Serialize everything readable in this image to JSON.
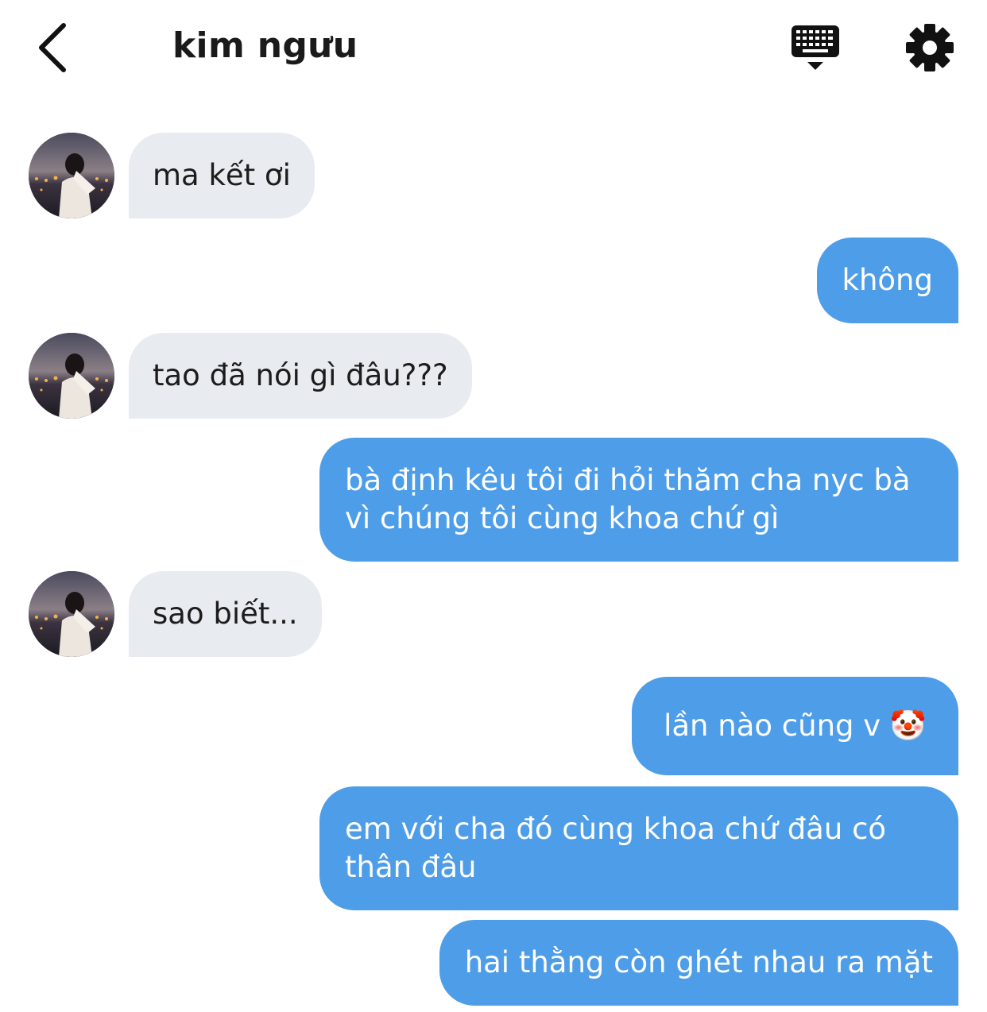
{
  "header": {
    "title": "kim ngưu",
    "back_icon": "chevron-left-icon",
    "keyboard_icon": "keyboard-icon",
    "settings_icon": "gear-icon"
  },
  "colors": {
    "incoming_bubble": "#e8ebef",
    "outgoing_bubble": "#4e9de8",
    "incoming_text": "#1c1c1c",
    "outgoing_text": "#ffffff"
  },
  "messages": [
    {
      "direction": "incoming",
      "text": "ma kết ơi"
    },
    {
      "direction": "outgoing",
      "text": "không"
    },
    {
      "direction": "incoming",
      "text": "tao đã nói gì đâu???"
    },
    {
      "direction": "outgoing",
      "text": "bà định kêu tôi đi hỏi thăm cha nyc bà vì chúng tôi cùng khoa chứ gì"
    },
    {
      "direction": "incoming",
      "text": "sao biết..."
    },
    {
      "direction": "outgoing",
      "text": "lần nào cũng v 🤡"
    },
    {
      "direction": "outgoing",
      "text": "em với cha đó cùng khoa chứ đâu có thân đâu"
    },
    {
      "direction": "outgoing",
      "text": "hai thằng còn ghét nhau ra mặt"
    }
  ]
}
